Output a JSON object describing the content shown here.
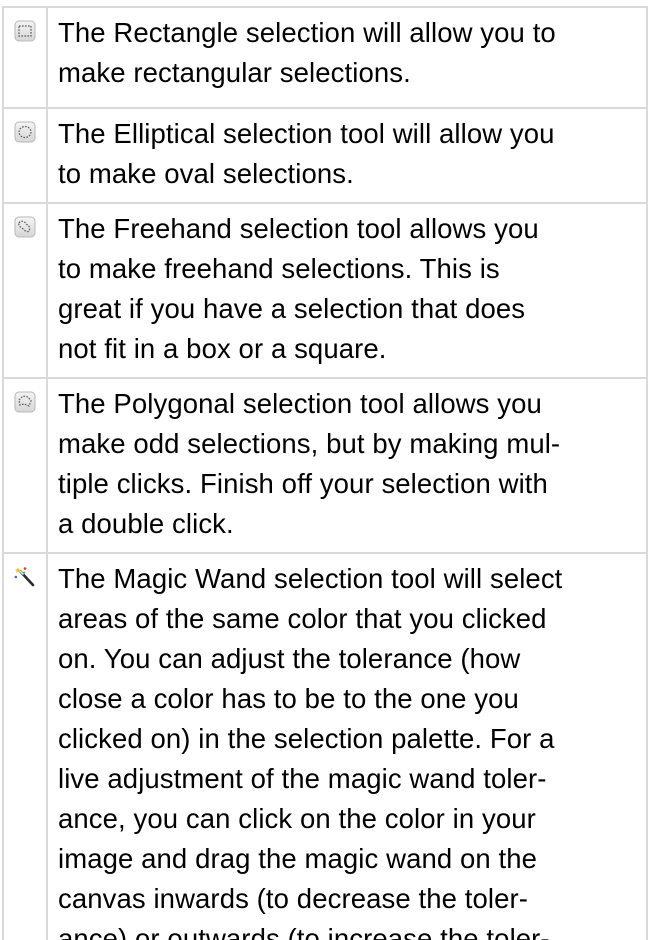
{
  "rows": [
    {
      "icon": "rectangle-select-icon",
      "text": "The Rectangle selection will allow you to\nmake rectangular selections."
    },
    {
      "icon": "ellipse-select-icon",
      "text": "The Elliptical selection tool will allow you\nto make oval selections."
    },
    {
      "icon": "lasso-select-icon",
      "text": "The Freehand selection tool allows you\nto make freehand selections.  This is\ngreat if you have a selection that does\nnot fit in a box or a square."
    },
    {
      "icon": "polygon-select-icon",
      "text": "The Polygonal selection tool allows you\nmake odd selections, but by making mul-\ntiple clicks.  Finish off your selection with\na double click."
    },
    {
      "icon": "magic-wand-icon",
      "text": "The Magic Wand selection tool will select\nareas of the same color that you clicked\non.  You can adjust the tolerance (how\nclose a color has to be to the one you\nclicked on) in the selection palette.  For a\nlive adjustment of the magic wand toler-\nance, you can click on the color in your\nimage and drag the magic wand on the\ncanvas inwards (to decrease the toler-\nance) or outwards (to increase the toler-\nance)."
    }
  ]
}
